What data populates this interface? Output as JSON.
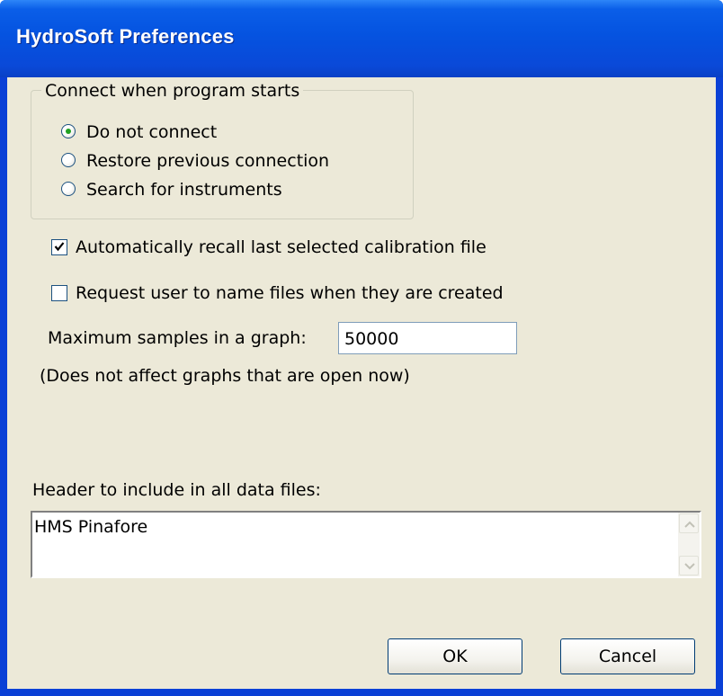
{
  "window": {
    "title": "HydroSoft Preferences"
  },
  "connect_group": {
    "label": "Connect when program starts",
    "options": [
      {
        "label": "Do not connect",
        "selected": true
      },
      {
        "label": "Restore previous connection",
        "selected": false
      },
      {
        "label": "Search for instruments",
        "selected": false
      }
    ]
  },
  "auto_recall": {
    "label": "Automatically recall last selected calibration file",
    "checked": true
  },
  "request_names": {
    "label": "Request user to name files when they are created",
    "checked": false
  },
  "max_samples": {
    "label": "Maximum samples in a graph:",
    "value": "50000",
    "note": "(Does not affect graphs that are open now)"
  },
  "header": {
    "label": "Header to include in all data files:",
    "value": "HMS Pinafore"
  },
  "buttons": {
    "ok": "OK",
    "cancel": "Cancel"
  }
}
